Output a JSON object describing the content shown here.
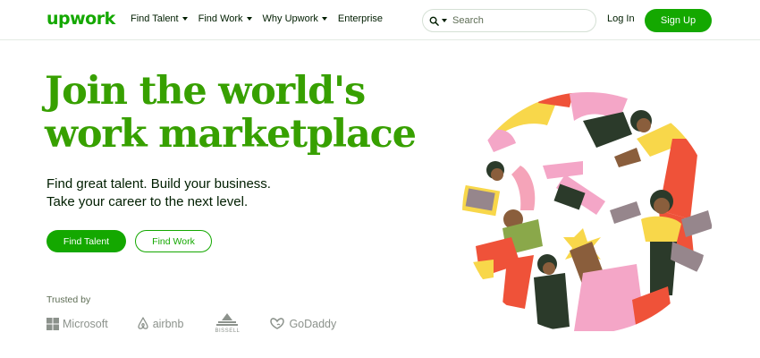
{
  "brand": {
    "logo": "upwork",
    "accent": "#14a800",
    "headline_color": "#37a000"
  },
  "nav": {
    "items": [
      {
        "label": "Find Talent",
        "has_dropdown": true
      },
      {
        "label": "Find Work",
        "has_dropdown": true
      },
      {
        "label": "Why Upwork",
        "has_dropdown": true
      },
      {
        "label": "Enterprise",
        "has_dropdown": false
      }
    ],
    "search": {
      "placeholder": "Search",
      "value": "",
      "icon": "search-icon"
    },
    "login_label": "Log In",
    "signup_label": "Sign Up"
  },
  "hero": {
    "title": "Join the world's work marketplace",
    "subtitle_line1": "Find great talent. Build your business.",
    "subtitle_line2": "Take your career to the next level.",
    "primary_cta": "Find Talent",
    "secondary_cta": "Find Work"
  },
  "trusted": {
    "label": "Trusted by",
    "logos": [
      {
        "name": "Microsoft",
        "icon": "microsoft-logo-icon"
      },
      {
        "name": "airbnb",
        "icon": "airbnb-logo-icon"
      },
      {
        "name": "BISSELL",
        "icon": "bissell-logo-icon"
      },
      {
        "name": "GoDaddy",
        "icon": "godaddy-logo-icon"
      }
    ]
  },
  "illustration": {
    "icon": "people-circle-illustration",
    "palette": [
      "#f8d74a",
      "#ef5239",
      "#f4a6c7",
      "#2b3a2a",
      "#96868c",
      "#f5a4b9",
      "#8a5e3c"
    ]
  }
}
